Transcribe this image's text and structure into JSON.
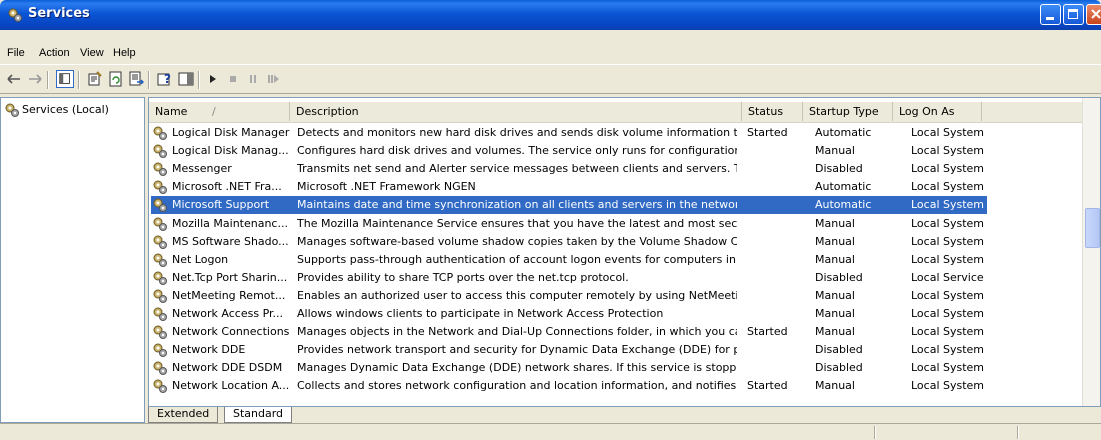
{
  "window": {
    "title": "Services"
  },
  "menu": [
    "File",
    "Action",
    "View",
    "Help"
  ],
  "tree": {
    "root_label": "Services (Local)"
  },
  "list": {
    "columns": [
      {
        "label": "Name",
        "sort_indicator": "/"
      },
      {
        "label": "Description"
      },
      {
        "label": "Status"
      },
      {
        "label": "Startup Type"
      },
      {
        "label": "Log On As"
      }
    ],
    "selected_index": 4,
    "rows": [
      {
        "name": "Logical Disk Manager",
        "description": "Detects and monitors new hard disk drives and sends disk volume information to ...",
        "status": "Started",
        "startup": "Automatic",
        "logon": "Local System"
      },
      {
        "name": "Logical Disk Manag...",
        "description": "Configures hard disk drives and volumes. The service only runs for configuration ...",
        "status": "",
        "startup": "Manual",
        "logon": "Local System"
      },
      {
        "name": "Messenger",
        "description": "Transmits net send and Alerter service messages between clients and servers. T...",
        "status": "",
        "startup": "Disabled",
        "logon": "Local System"
      },
      {
        "name": "Microsoft .NET Fra...",
        "description": "Microsoft .NET Framework NGEN",
        "status": "",
        "startup": "Automatic",
        "logon": "Local System"
      },
      {
        "name": "Microsoft Support",
        "description": "Maintains date and time synchronization on all clients and servers in the network....",
        "status": "",
        "startup": "Automatic",
        "logon": "Local System"
      },
      {
        "name": "Mozilla Maintenanc...",
        "description": "The Mozilla Maintenance Service ensures that you have the latest and most secu...",
        "status": "",
        "startup": "Manual",
        "logon": "Local System"
      },
      {
        "name": "MS Software Shado...",
        "description": "Manages software-based volume shadow copies taken by the Volume Shadow Co...",
        "status": "",
        "startup": "Manual",
        "logon": "Local System"
      },
      {
        "name": "Net Logon",
        "description": "Supports pass-through authentication of account logon events for computers in ...",
        "status": "",
        "startup": "Manual",
        "logon": "Local System"
      },
      {
        "name": "Net.Tcp Port Sharin...",
        "description": "Provides ability to share TCP ports over the net.tcp protocol.",
        "status": "",
        "startup": "Disabled",
        "logon": "Local Service"
      },
      {
        "name": "NetMeeting Remot...",
        "description": "Enables an authorized user to access this computer remotely by using NetMeetin...",
        "status": "",
        "startup": "Manual",
        "logon": "Local System"
      },
      {
        "name": "Network Access Pr...",
        "description": "Allows windows clients to participate in Network Access Protection",
        "status": "",
        "startup": "Manual",
        "logon": "Local System"
      },
      {
        "name": "Network Connections",
        "description": "Manages objects in the Network and Dial-Up Connections folder, in which you ca...",
        "status": "Started",
        "startup": "Manual",
        "logon": "Local System"
      },
      {
        "name": "Network DDE",
        "description": "Provides network transport and security for Dynamic Data Exchange (DDE) for pr...",
        "status": "",
        "startup": "Disabled",
        "logon": "Local System"
      },
      {
        "name": "Network DDE DSDM",
        "description": "Manages Dynamic Data Exchange (DDE) network shares. If this service is stoppe...",
        "status": "",
        "startup": "Disabled",
        "logon": "Local System"
      },
      {
        "name": "Network Location A...",
        "description": "Collects and stores network configuration and location information, and notifies a...",
        "status": "Started",
        "startup": "Manual",
        "logon": "Local System"
      }
    ]
  },
  "tabs": [
    "Extended",
    "Standard"
  ],
  "active_tab": "Standard",
  "colors": {
    "selection": "#316ac5",
    "titlebar": "#0b55d4"
  },
  "toolbar_icons": [
    "back-icon",
    "forward-icon",
    "show-hide-tree-icon",
    "properties-icon",
    "refresh-icon",
    "export-list-icon",
    "help-icon",
    "show-hide-action-pane-icon",
    "start-service-icon",
    "stop-service-icon",
    "pause-service-icon",
    "restart-service-icon"
  ]
}
